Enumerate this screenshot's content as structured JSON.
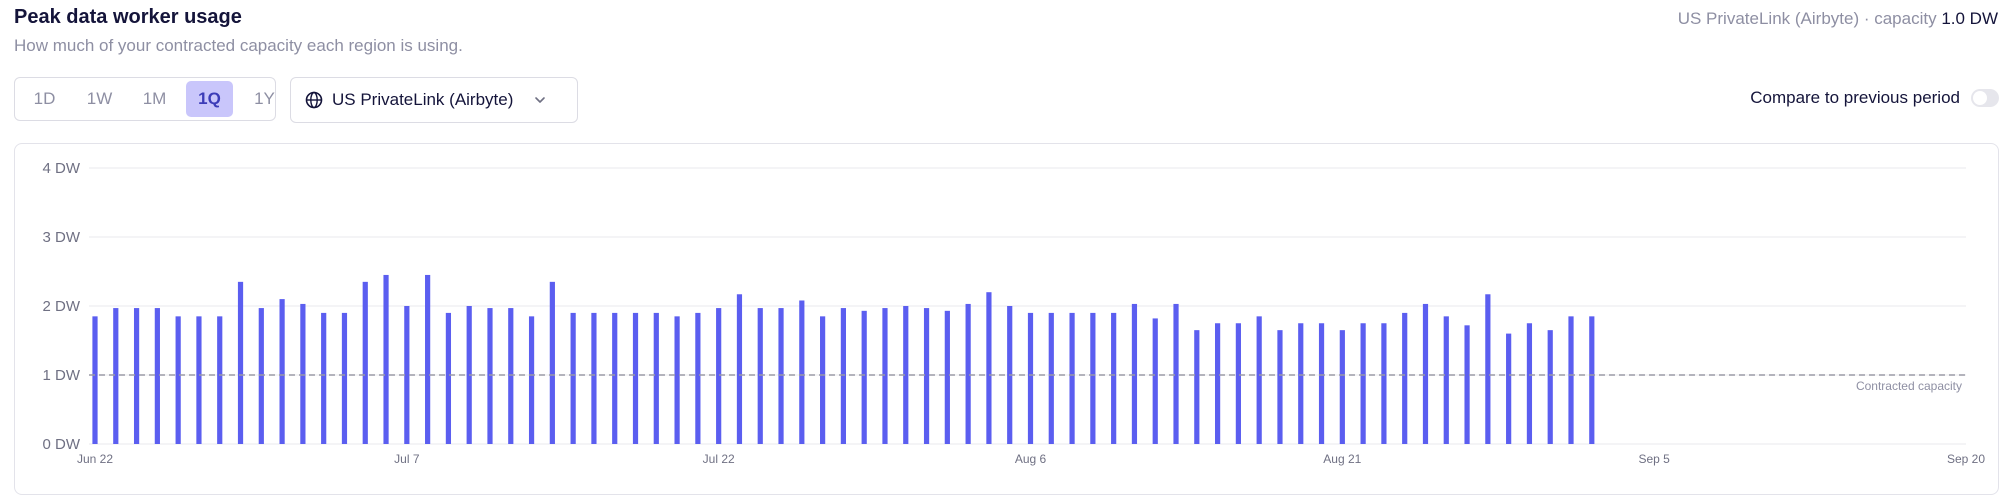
{
  "header": {
    "title": "Peak data worker usage",
    "subtitle": "How much of your contracted capacity each region is using.",
    "capacity_prefix": "US PrivateLink (Airbyte) · capacity ",
    "capacity_value": "1.0 DW"
  },
  "controls": {
    "ranges": [
      {
        "label": "1D",
        "active": false
      },
      {
        "label": "1W",
        "active": false
      },
      {
        "label": "1M",
        "active": false
      },
      {
        "label": "1Q",
        "active": true
      },
      {
        "label": "1Y",
        "active": false
      }
    ],
    "region": {
      "label": "US PrivateLink (Airbyte)",
      "icon": "globe-icon"
    },
    "compare_label": "Compare to previous period",
    "compare_enabled": false
  },
  "colors": {
    "bar": "#5b5ef0",
    "grid": "#e8e8ee",
    "capacity_line": "#9a9aa6"
  },
  "chart_data": {
    "type": "bar",
    "y_ticks": [
      "0 DW",
      "1 DW",
      "2 DW",
      "3 DW",
      "4 DW"
    ],
    "ylim": [
      0,
      4
    ],
    "y_unit": "DW",
    "x_tick_labels": [
      "Jun 22",
      "Jul 7",
      "Jul 22",
      "Aug 6",
      "Aug 21",
      "Sep 5",
      "Sep 20"
    ],
    "x_tick_dates": [
      "2025-06-22",
      "2025-07-07",
      "2025-07-22",
      "2025-08-06",
      "2025-08-21",
      "2025-09-05",
      "2025-09-20"
    ],
    "x_range": [
      "2025-06-22",
      "2025-09-20"
    ],
    "first_date": "2025-06-22",
    "values": [
      1.85,
      1.97,
      1.97,
      1.97,
      1.85,
      1.85,
      1.85,
      2.35,
      1.97,
      2.1,
      2.03,
      1.9,
      1.9,
      2.35,
      2.45,
      2.0,
      2.45,
      1.9,
      2.0,
      1.97,
      1.97,
      1.85,
      2.35,
      1.9,
      1.9,
      1.9,
      1.9,
      1.9,
      1.85,
      1.9,
      1.97,
      2.17,
      1.97,
      1.97,
      2.08,
      1.85,
      1.97,
      1.93,
      1.97,
      2.0,
      1.97,
      1.93,
      2.03,
      2.2,
      2.0,
      1.9,
      1.9,
      1.9,
      1.9,
      1.9,
      2.03,
      1.82,
      2.03,
      1.65,
      1.75,
      1.75,
      1.85,
      1.65,
      1.75,
      1.75,
      1.65,
      1.75,
      1.75,
      1.9,
      2.03,
      1.85,
      1.72,
      2.17,
      1.6,
      1.75,
      1.65,
      1.85,
      1.85
    ],
    "reference_line": {
      "value": 1.0,
      "label": "Contracted capacity"
    },
    "grid": true
  }
}
